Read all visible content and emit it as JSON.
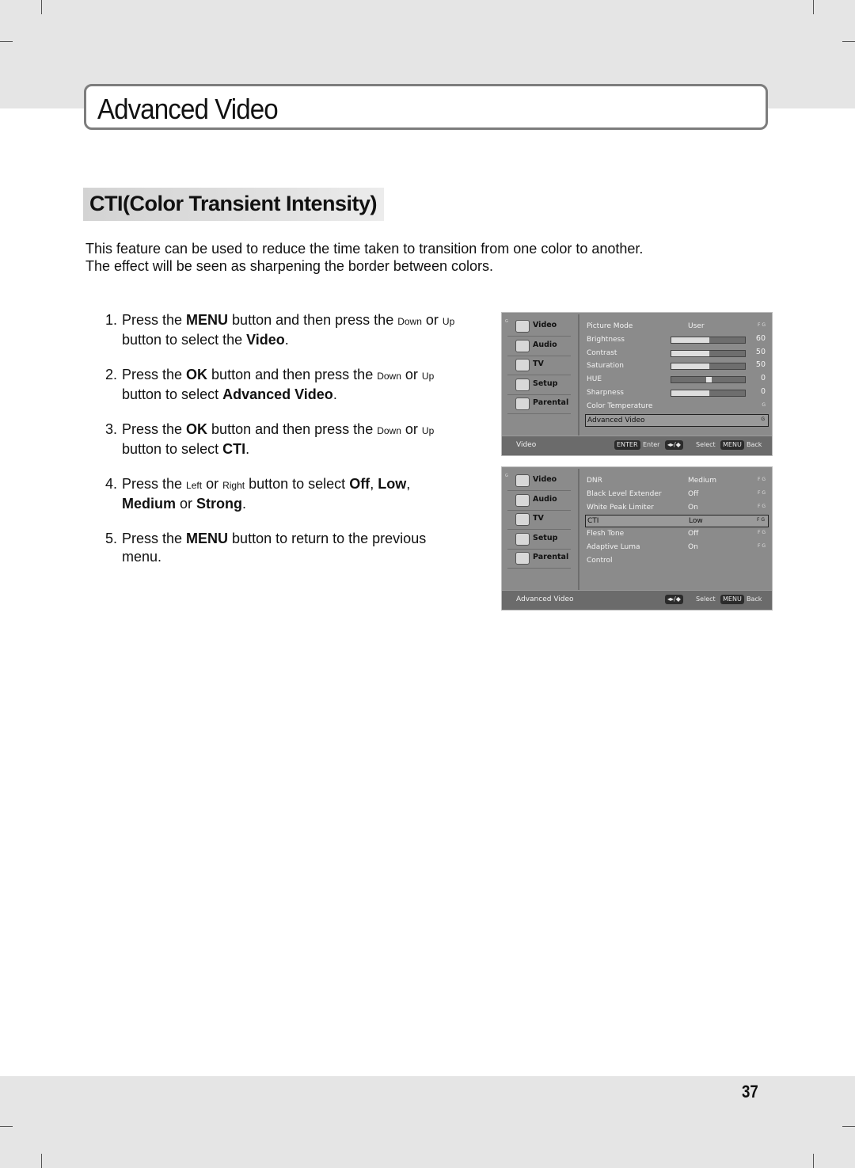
{
  "page": {
    "title": "Advanced Video",
    "section_heading": "CTI(Color Transient Intensity)",
    "intro_lines": [
      "This feature can be used to reduce the time taken to transition from one color to another.",
      "The effect will be seen as sharpening the border between colors."
    ],
    "page_number": "37"
  },
  "steps": [
    {
      "num": "1.",
      "parts": [
        {
          "t": "Press the ",
          "s": "n"
        },
        {
          "t": "MENU",
          "s": "b"
        },
        {
          "t": " button and then press the ",
          "s": "n"
        },
        {
          "t": "Down",
          "s": "s"
        },
        {
          "t": " or ",
          "s": "n"
        },
        {
          "t": "Up",
          "s": "s"
        },
        {
          "t": " button to select the ",
          "s": "n"
        },
        {
          "t": "Video",
          "s": "b"
        },
        {
          "t": ".",
          "s": "n"
        }
      ]
    },
    {
      "num": "2.",
      "parts": [
        {
          "t": "Press the ",
          "s": "n"
        },
        {
          "t": "OK",
          "s": "b"
        },
        {
          "t": " button and then press the ",
          "s": "n"
        },
        {
          "t": "Down",
          "s": "s"
        },
        {
          "t": " or ",
          "s": "n"
        },
        {
          "t": "Up",
          "s": "s"
        },
        {
          "t": " button to select ",
          "s": "n"
        },
        {
          "t": "Advanced Video",
          "s": "b"
        },
        {
          "t": ".",
          "s": "n"
        }
      ]
    },
    {
      "num": "3.",
      "parts": [
        {
          "t": "Press the ",
          "s": "n"
        },
        {
          "t": "OK",
          "s": "b"
        },
        {
          "t": " button and then press the ",
          "s": "n"
        },
        {
          "t": "Down",
          "s": "s"
        },
        {
          "t": " or ",
          "s": "n"
        },
        {
          "t": "Up",
          "s": "s"
        },
        {
          "t": " button to select ",
          "s": "n"
        },
        {
          "t": "CTI",
          "s": "b"
        },
        {
          "t": ".",
          "s": "n"
        }
      ]
    },
    {
      "num": "4.",
      "parts": [
        {
          "t": "Press the ",
          "s": "n"
        },
        {
          "t": "Left",
          "s": "s"
        },
        {
          "t": " or ",
          "s": "n"
        },
        {
          "t": "Right",
          "s": "s"
        },
        {
          "t": " button to select ",
          "s": "n"
        },
        {
          "t": "Off",
          "s": "b"
        },
        {
          "t": ", ",
          "s": "n"
        },
        {
          "t": "Low",
          "s": "b"
        },
        {
          "t": ", ",
          "s": "n"
        },
        {
          "t": "Medium",
          "s": "b"
        },
        {
          "t": " or ",
          "s": "n"
        },
        {
          "t": "Strong",
          "s": "b"
        },
        {
          "t": ".",
          "s": "n"
        }
      ]
    },
    {
      "num": "5.",
      "parts": [
        {
          "t": "Press the ",
          "s": "n"
        },
        {
          "t": "MENU",
          "s": "b"
        },
        {
          "t": " button to return to the previous menu.",
          "s": "n"
        }
      ]
    }
  ],
  "osd_sidebar": [
    {
      "label": "Video",
      "icon": "video-icon"
    },
    {
      "label": "Audio",
      "icon": "audio-icon"
    },
    {
      "label": "TV",
      "icon": "tv-icon"
    },
    {
      "label": "Setup",
      "icon": "setup-icon"
    },
    {
      "label": "Parental",
      "icon": "parental-icon"
    }
  ],
  "osd_video": {
    "rows": [
      {
        "name": "Picture Mode",
        "value": "User",
        "marker": "F G"
      },
      {
        "name": "Brightness",
        "level": 60,
        "slider": true
      },
      {
        "name": "Contrast",
        "level": 50,
        "slider": true
      },
      {
        "name": "Saturation",
        "level": 50,
        "slider": true
      },
      {
        "name": "HUE",
        "level": 0,
        "slider": true,
        "centered": true
      },
      {
        "name": "Sharpness",
        "level": 0,
        "slider": true
      },
      {
        "name": "Color Temperature",
        "marker": "G"
      },
      {
        "name": "Advanced Video",
        "marker": "G",
        "selected": true
      }
    ],
    "footer": {
      "crumb": "Video",
      "keys": [
        {
          "key": "ENTER",
          "label": "Enter"
        },
        {
          "key": "◂▸/◆",
          "label": "Select"
        },
        {
          "key": "MENU",
          "label": "Back"
        }
      ]
    }
  },
  "osd_advanced": {
    "rows": [
      {
        "name": "DNR",
        "value": "Medium",
        "marker": "F G"
      },
      {
        "name": "Black Level Extender",
        "value": "Off",
        "marker": "F G"
      },
      {
        "name": "White Peak Limiter",
        "value": "On",
        "marker": "F G"
      },
      {
        "name": "CTI",
        "value": "Low",
        "marker": "F G",
        "selected": true
      },
      {
        "name": "Flesh Tone",
        "value": "Off",
        "marker": "F G"
      },
      {
        "name": "Adaptive Luma",
        "value": "On",
        "marker": "F G"
      },
      {
        "name": "Control"
      }
    ],
    "footer": {
      "crumb": "Advanced Video",
      "keys": [
        {
          "key": "◂▸/◆",
          "label": "Select"
        },
        {
          "key": "MENU",
          "label": "Back"
        }
      ]
    }
  }
}
